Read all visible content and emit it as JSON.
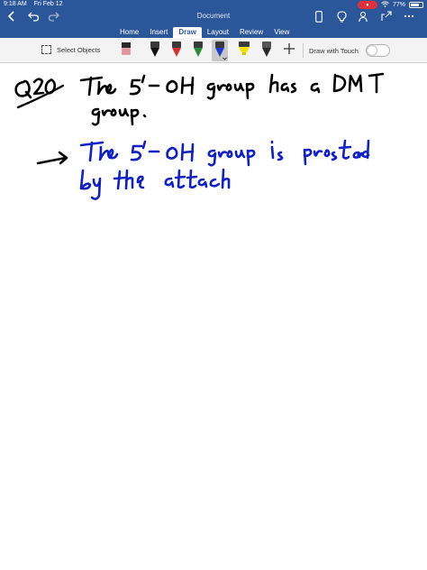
{
  "status_bar": {
    "time": "9:18 AM",
    "date": "Fri Feb 12",
    "battery": "77%",
    "battery_level": 0.77
  },
  "document": {
    "title": "Document"
  },
  "tabs": [
    {
      "label": "Home",
      "active": false
    },
    {
      "label": "Insert",
      "active": false
    },
    {
      "label": "Draw",
      "active": true
    },
    {
      "label": "Layout",
      "active": false
    },
    {
      "label": "Review",
      "active": false
    },
    {
      "label": "View",
      "active": false
    }
  ],
  "ribbon": {
    "select_objects_label": "Select Objects",
    "draw_with_touch_label": "Draw with Touch",
    "draw_with_touch_on": false,
    "pens": [
      {
        "name": "eraser",
        "color": "#e8a0a8"
      },
      {
        "name": "pen-black",
        "color": "#111111"
      },
      {
        "name": "pen-red",
        "color": "#d2322d"
      },
      {
        "name": "pen-green",
        "color": "#2e8b3e"
      },
      {
        "name": "pen-blue",
        "color": "#1c3fd1",
        "selected": true
      },
      {
        "name": "highlighter-yellow",
        "color": "#f5e400"
      },
      {
        "name": "pencil-dark",
        "color": "#2a2a2a"
      }
    ]
  },
  "colors": {
    "header": "#2b579a",
    "ink_black": "#000000",
    "ink_blue": "#1020c8"
  }
}
